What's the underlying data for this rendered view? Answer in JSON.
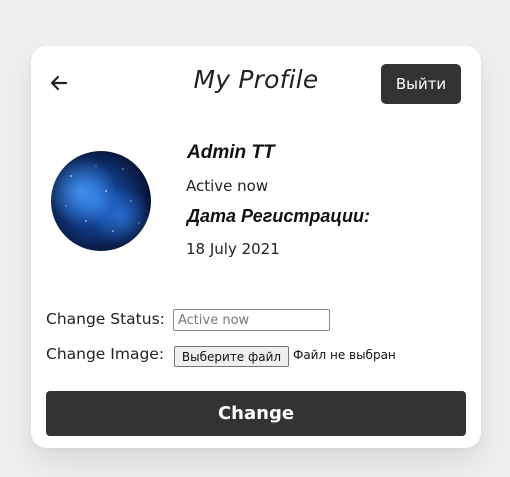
{
  "header": {
    "back_icon": "arrow-left-icon",
    "title": "My Profile",
    "logout_label": "Выйти"
  },
  "profile": {
    "avatar": "space-nebula-image",
    "name": "Admin TT",
    "status": "Active now",
    "registration_label": "Дата Регистрации:",
    "registration_date": "18 July 2021"
  },
  "form": {
    "status_label": "Change Status:",
    "status_placeholder": "Active now",
    "image_label": "Change Image:",
    "file_button_label": "Выберите файл",
    "file_none_label": "Файл не выбран",
    "submit_label": "Change"
  },
  "colors": {
    "page_bg": "#f0f0f0",
    "card_bg": "#ffffff",
    "button_bg": "#333333",
    "button_text": "#ffffff"
  }
}
